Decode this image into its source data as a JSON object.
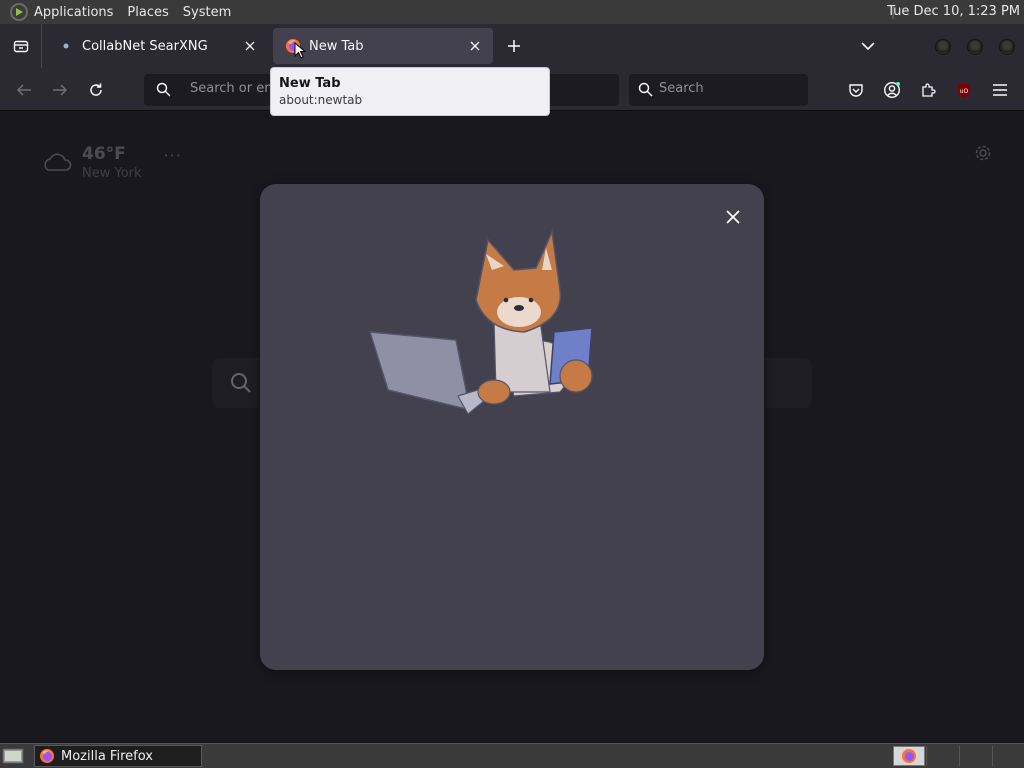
{
  "top_panel": {
    "menus": [
      "Applications",
      "Places",
      "System"
    ],
    "clock": "Tue Dec 10,  1:23 PM"
  },
  "tabs": [
    {
      "title": "CollabNet SearXNG",
      "active": false
    },
    {
      "title": "New Tab",
      "active": true
    }
  ],
  "tooltip": {
    "title": "New Tab",
    "url": "about:newtab"
  },
  "urlbar": {
    "placeholder": "Search or enter address"
  },
  "searchbar": {
    "placeholder": "Search"
  },
  "weather": {
    "temp": "46°F",
    "location": "New York"
  },
  "taskbar": {
    "window_title": "Mozilla Firefox"
  },
  "colors": {
    "accent_firefox": "#ff7139",
    "modal_bg": "#42414d",
    "content_bg": "#1c1b22"
  }
}
